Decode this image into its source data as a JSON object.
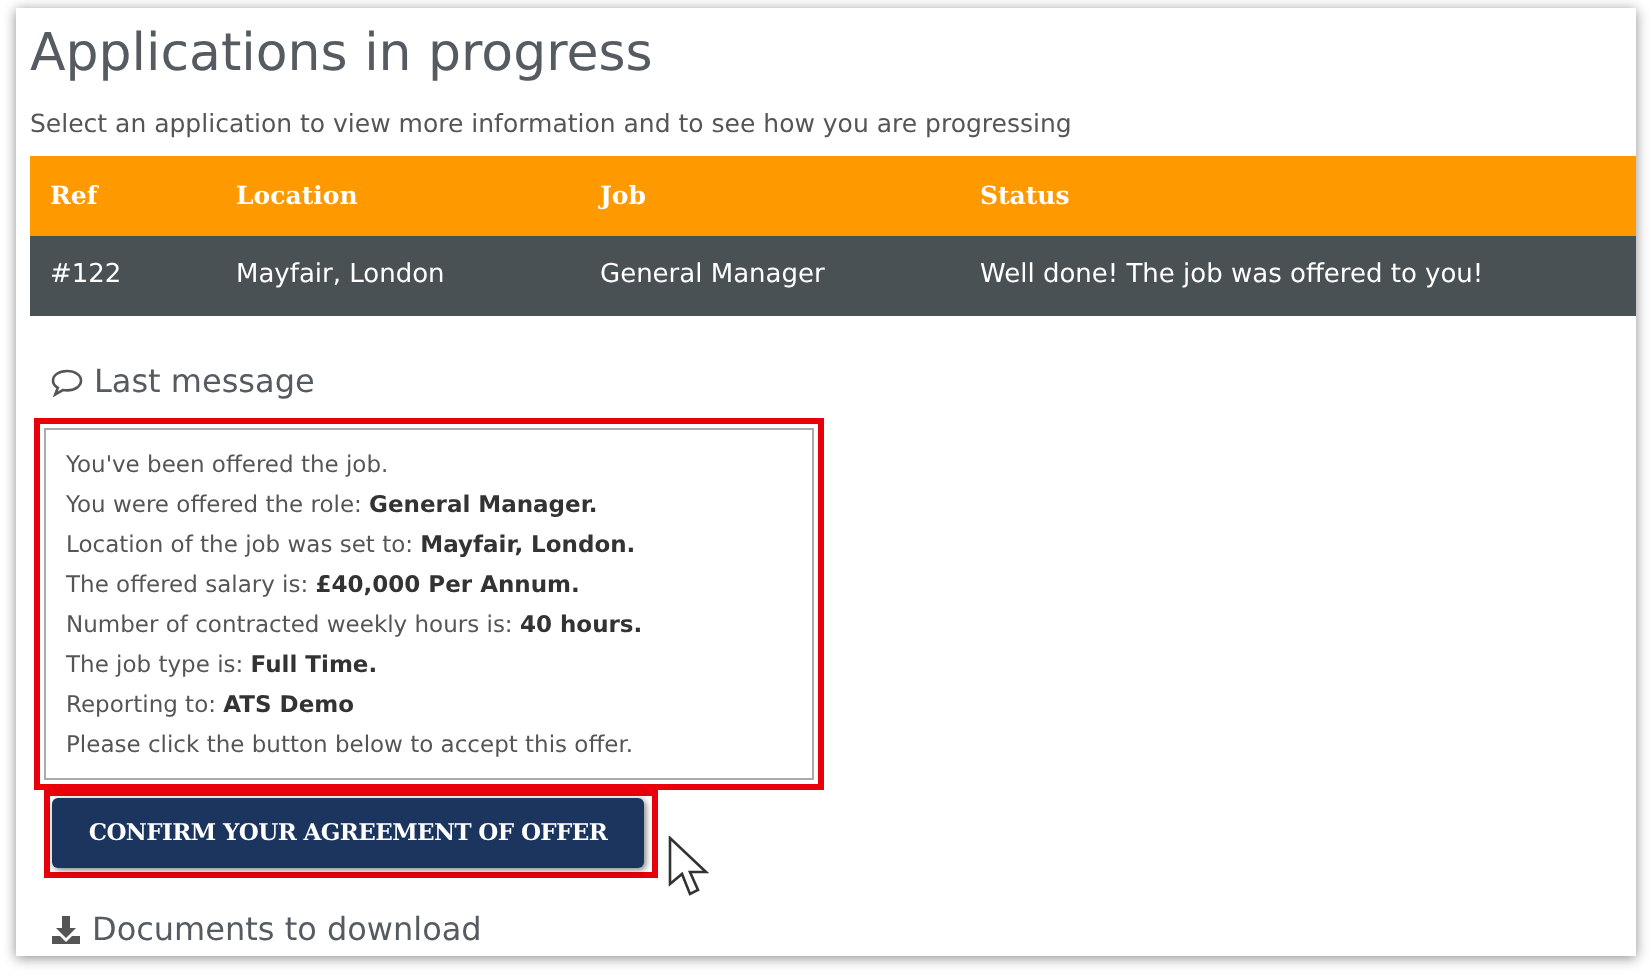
{
  "page": {
    "title": "Applications in progress",
    "subtitle": "Select an application to view more information and to see how you are progressing"
  },
  "table": {
    "columns": [
      "Ref",
      "Location",
      "Job",
      "Status"
    ],
    "rows": [
      {
        "cells": [
          "#122",
          "Mayfair, London",
          "General Manager",
          "Well done! The job was offered to you!"
        ]
      }
    ]
  },
  "last_message": {
    "heading": "Last message",
    "lines": [
      "You've been offered the job.",
      "You were offered the role: **General Manager.**",
      "Location of the job was set to: **Mayfair, London.**",
      "The offered salary is: **£40,000 Per Annum.**",
      "Number of contracted weekly hours is: **40 hours.**",
      "The job type is: **Full Time.**",
      "Reporting to: **ATS Demo**",
      "Please click the button below to accept this offer."
    ]
  },
  "confirm_button": "CONFIRM YOUR AGREEMENT OF OFFER",
  "documents": {
    "heading": "Documents to download"
  }
}
